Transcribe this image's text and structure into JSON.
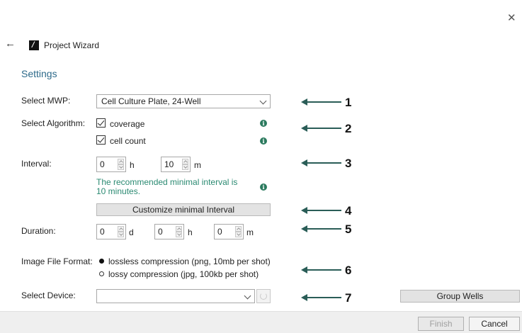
{
  "window": {
    "title": "Project Wizard",
    "section": "Settings"
  },
  "mwp": {
    "label": "Select MWP:",
    "value": "Cell Culture Plate, 24-Well"
  },
  "algorithm": {
    "label": "Select Algorithm:",
    "options": [
      {
        "label": "coverage",
        "checked": true
      },
      {
        "label": "cell count",
        "checked": true
      }
    ]
  },
  "interval": {
    "label": "Interval:",
    "hours": "0",
    "hours_unit": "h",
    "minutes": "10",
    "minutes_unit": "m",
    "hint": "The recommended minimal interval is 10 minutes.",
    "customize_button": "Customize minimal Interval"
  },
  "duration": {
    "label": "Duration:",
    "days": "0",
    "days_unit": "d",
    "hours": "0",
    "hours_unit": "h",
    "minutes": "0",
    "minutes_unit": "m"
  },
  "image_format": {
    "label": "Image File Format:",
    "options": [
      {
        "label": "lossless compression (png, 10mb per shot)",
        "selected": true
      },
      {
        "label": "lossy compression (jpg, 100kb per shot)",
        "selected": false
      }
    ]
  },
  "device": {
    "label": "Select Device:",
    "value": "",
    "group_wells_button": "Group Wells"
  },
  "callouts": [
    "1",
    "2",
    "3",
    "4",
    "5",
    "6",
    "7"
  ],
  "footer": {
    "finish": "Finish",
    "cancel": "Cancel"
  },
  "icons": {
    "close": "close-icon",
    "back": "back-arrow-icon",
    "logo": "app-logo-icon",
    "info": "info-icon",
    "refresh": "refresh-icon",
    "chevron": "chevron-down-icon"
  },
  "colors": {
    "accent": "#2d6a8a",
    "hint": "#2b8a72",
    "arrow": "#2a5d57"
  }
}
